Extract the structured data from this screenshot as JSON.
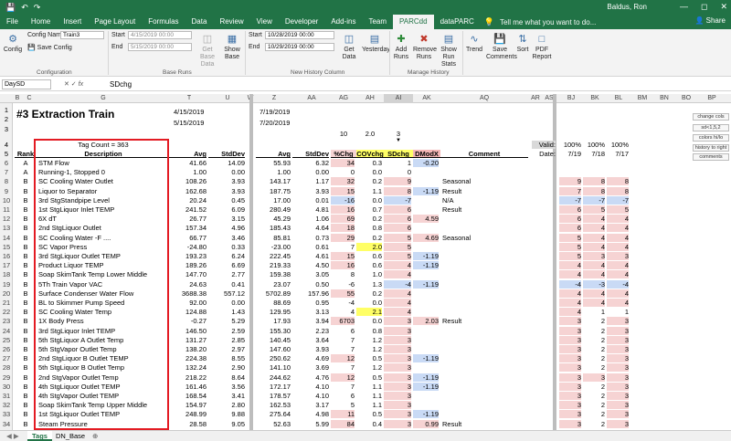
{
  "window": {
    "title": "",
    "user": "Baldus, Ron",
    "share": "Share"
  },
  "tabs": [
    "File",
    "Home",
    "Insert",
    "Page Layout",
    "Formulas",
    "Data",
    "Review",
    "View",
    "Developer",
    "Add-ins",
    "Team",
    "PARCdd",
    "dataPARC"
  ],
  "active_tab": "PARCdd",
  "tell_me": "Tell me what you want to do...",
  "ribbon": {
    "config_label": "Config",
    "config_name_label": "Config Name",
    "config_name_value": "Train3",
    "save_config": "Save Config",
    "start_label": "Start",
    "end_label": "End",
    "base_start": "4/15/2019 00:00",
    "base_end": "5/15/2019 00:00",
    "get_base_data": "Get Base Data",
    "show_base": "Show Base",
    "new_start": "10/28/2019 00:00",
    "new_end": "10/29/2019 00:00",
    "get_data": "Get Data",
    "yesterday": "Yesterday",
    "add_runs": "Add Runs",
    "remove_runs": "Remove Runs",
    "show_run_stats": "Show Run Stats",
    "trend": "Trend",
    "save_comments": "Save Comments",
    "sort": "Sort",
    "pdf_report": "PDF Report",
    "group_configuration": "Configuration",
    "group_base_runs": "Base Runs",
    "group_new_history": "New History Column",
    "group_manage_history": "Manage History"
  },
  "formula_bar": {
    "name_box": "DaySD",
    "formula": "SDchg",
    "fx": "fx"
  },
  "columns": [
    "B",
    "C",
    "G",
    "T",
    "U",
    "W",
    "Z",
    "AA",
    "AG",
    "AH",
    "AI",
    "AK",
    "AQ",
    "AR",
    "AS",
    "BJ",
    "BK",
    "BL",
    "BM",
    "BN",
    "BO",
    "BP"
  ],
  "sheet": {
    "title": "#3 Extraction Train",
    "base_start": "4/15/2019",
    "base_end": "5/15/2019",
    "new_start": "7/19/2019",
    "new_end": "7/20/2019",
    "weights": [
      "10",
      "2.0",
      "3"
    ],
    "tag_count": "Tag Count = 363",
    "valid_label": "Valid:",
    "date_label": "Date:",
    "valid_pcts": [
      "100%",
      "100%",
      "100%"
    ],
    "dates": [
      "7/19",
      "7/18",
      "7/17"
    ],
    "headers": {
      "rank": "Rank",
      "desc": "Description",
      "avg": "Avg",
      "stddev": "StdDev",
      "avg2": "Avg",
      "stddev2": "StdDev",
      "pchg": "%Chg",
      "covchg": "COVchg",
      "sdchg": "SDchg",
      "dmodx": "DModX",
      "comment": "Comment"
    }
  },
  "side_buttons": [
    "change cols",
    "sd<1,5,2",
    "colors hi/lo",
    "history to right",
    "comments"
  ],
  "rows": [
    {
      "n": "6",
      "rank": "A",
      "desc": "STM Flow",
      "avg": "41.66",
      "sd": "14.09",
      "avg2": "55.93",
      "sd2": "6.32",
      "pchg": "34",
      "cov": "0.3",
      "sdc": "1",
      "dmx": "-0.20",
      "cm": "",
      "h": [
        "",
        "",
        ""
      ]
    },
    {
      "n": "7",
      "rank": "A",
      "desc": "Running-1, Stopped 0",
      "avg": "1.00",
      "sd": "0.00",
      "avg2": "1.00",
      "sd2": "0.00",
      "pchg": "0",
      "cov": "0.0",
      "sdc": "0",
      "dmx": "",
      "cm": "",
      "h": [
        "",
        "",
        ""
      ]
    },
    {
      "n": "8",
      "rank": "B",
      "desc": "SC Cooling Water Outlet",
      "avg": "108.26",
      "sd": "3.93",
      "avg2": "143.17",
      "sd2": "1.17",
      "pchg": "32",
      "cov": "0.2",
      "sdc": "9",
      "dmx": "",
      "cm": "Seasonal",
      "h": [
        "9",
        "8",
        "8"
      ]
    },
    {
      "n": "9",
      "rank": "B",
      "desc": "Liquor to Separator",
      "avg": "162.68",
      "sd": "3.93",
      "avg2": "187.75",
      "sd2": "3.93",
      "pchg": "15",
      "cov": "1.1",
      "sdc": "8",
      "dmx": "-1.19",
      "cm": "Result",
      "h": [
        "7",
        "8",
        "8"
      ]
    },
    {
      "n": "10",
      "rank": "B",
      "desc": "3rd StgStandpipe Level",
      "avg": "20.24",
      "sd": "0.45",
      "avg2": "17.00",
      "sd2": "0.01",
      "pchg": "-16",
      "cov": "0.0",
      "sdc": "-7",
      "dmx": "",
      "cm": "N/A",
      "h": [
        "-7",
        "-7",
        "-7"
      ]
    },
    {
      "n": "11",
      "rank": "B",
      "desc": "1st StgLiquor Inlet TEMP",
      "avg": "241.52",
      "sd": "6.09",
      "avg2": "280.49",
      "sd2": "4.81",
      "pchg": "16",
      "cov": "0.7",
      "sdc": "6",
      "dmx": "",
      "cm": "Result",
      "h": [
        "6",
        "5",
        "5"
      ]
    },
    {
      "n": "12",
      "rank": "B",
      "desc": "6X dT",
      "avg": "26.77",
      "sd": "3.15",
      "avg2": "45.29",
      "sd2": "1.06",
      "pchg": "69",
      "cov": "0.2",
      "sdc": "6",
      "dmx": "4.59",
      "cm": "",
      "h": [
        "6",
        "4",
        "4"
      ]
    },
    {
      "n": "13",
      "rank": "B",
      "desc": "2nd StgLiquor Outlet",
      "avg": "157.34",
      "sd": "4.96",
      "avg2": "185.43",
      "sd2": "4.64",
      "pchg": "18",
      "cov": "0.8",
      "sdc": "6",
      "dmx": "",
      "cm": "",
      "h": [
        "6",
        "4",
        "4"
      ]
    },
    {
      "n": "14",
      "rank": "B",
      "desc": "SC Cooling Water -F ....",
      "avg": "66.77",
      "sd": "3.46",
      "avg2": "85.81",
      "sd2": "0.73",
      "pchg": "29",
      "cov": "0.2",
      "sdc": "5",
      "dmx": "4.69",
      "cm": "Seasonal",
      "h": [
        "5",
        "4",
        "4"
      ]
    },
    {
      "n": "15",
      "rank": "B",
      "desc": "SC Vapor Press",
      "avg": "-24.80",
      "sd": "0.33",
      "avg2": "-23.00",
      "sd2": "0.61",
      "pchg": "7",
      "cov": "2.0",
      "sdc": "5",
      "dmx": "",
      "cm": "",
      "h": [
        "5",
        "4",
        "4"
      ]
    },
    {
      "n": "16",
      "rank": "B",
      "desc": "3rd StgLiquor Outlet TEMP",
      "avg": "193.23",
      "sd": "6.24",
      "avg2": "222.45",
      "sd2": "4.61",
      "pchg": "15",
      "cov": "0.6",
      "sdc": "5",
      "dmx": "-1.19",
      "cm": "",
      "h": [
        "5",
        "3",
        "3"
      ]
    },
    {
      "n": "17",
      "rank": "B",
      "desc": "Product Liquor TEMP",
      "avg": "189.26",
      "sd": "6.69",
      "avg2": "219.33",
      "sd2": "4.50",
      "pchg": "16",
      "cov": "0.6",
      "sdc": "4",
      "dmx": "-1.19",
      "cm": "",
      "h": [
        "4",
        "4",
        "4"
      ]
    },
    {
      "n": "18",
      "rank": "B",
      "desc": "Soap SkimTank Temp Lower Middle",
      "avg": "147.70",
      "sd": "2.77",
      "avg2": "159.38",
      "sd2": "3.05",
      "pchg": "8",
      "cov": "1.0",
      "sdc": "4",
      "dmx": "",
      "cm": "",
      "h": [
        "4",
        "4",
        "4"
      ]
    },
    {
      "n": "19",
      "rank": "B",
      "desc": "5Th Train Vapor VAC",
      "avg": "24.63",
      "sd": "0.41",
      "avg2": "23.07",
      "sd2": "0.50",
      "pchg": "-6",
      "cov": "1.3",
      "sdc": "-4",
      "dmx": "-1.19",
      "cm": "",
      "h": [
        "-4",
        "-3",
        "-4"
      ]
    },
    {
      "n": "20",
      "rank": "B",
      "desc": "Surface Condenser Water Flow",
      "avg": "3688.38",
      "sd": "557.12",
      "avg2": "5702.89",
      "sd2": "157.96",
      "pchg": "55",
      "cov": "0.2",
      "sdc": "4",
      "dmx": "",
      "cm": "",
      "h": [
        "4",
        "4",
        "4"
      ]
    },
    {
      "n": "21",
      "rank": "B",
      "desc": "BL to Skimmer Pump Speed",
      "avg": "92.00",
      "sd": "0.00",
      "avg2": "88.69",
      "sd2": "0.95",
      "pchg": "-4",
      "cov": "0.0",
      "sdc": "4",
      "dmx": "",
      "cm": "",
      "h": [
        "4",
        "4",
        "4"
      ]
    },
    {
      "n": "22",
      "rank": "B",
      "desc": "SC Cooling Water Temp",
      "avg": "124.88",
      "sd": "1.43",
      "avg2": "129.95",
      "sd2": "3.13",
      "pchg": "4",
      "cov": "2.1",
      "sdc": "4",
      "dmx": "",
      "cm": "",
      "h": [
        "4",
        "1",
        "1"
      ]
    },
    {
      "n": "23",
      "rank": "B",
      "desc": "1X Body Press",
      "avg": "-0.27",
      "sd": "5.29",
      "avg2": "17.93",
      "sd2": "3.94",
      "pchg": "6703",
      "cov": "0.0",
      "sdc": "3",
      "dmx": "2.03",
      "cm": "Result",
      "h": [
        "3",
        "2",
        "3"
      ]
    },
    {
      "n": "24",
      "rank": "B",
      "desc": "3rd StgLiquor Inlet TEMP",
      "avg": "146.50",
      "sd": "2.59",
      "avg2": "155.30",
      "sd2": "2.23",
      "pchg": "6",
      "cov": "0.8",
      "sdc": "3",
      "dmx": "",
      "cm": "",
      "h": [
        "3",
        "2",
        "3"
      ]
    },
    {
      "n": "25",
      "rank": "B",
      "desc": "5th StgLiquor A Outlet Temp",
      "avg": "131.27",
      "sd": "2.85",
      "avg2": "140.45",
      "sd2": "3.64",
      "pchg": "7",
      "cov": "1.2",
      "sdc": "3",
      "dmx": "",
      "cm": "",
      "h": [
        "3",
        "2",
        "3"
      ]
    },
    {
      "n": "26",
      "rank": "B",
      "desc": "5th StgVapor Outlet Temp",
      "avg": "138.20",
      "sd": "2.97",
      "avg2": "147.60",
      "sd2": "3.93",
      "pchg": "7",
      "cov": "1.2",
      "sdc": "3",
      "dmx": "",
      "cm": "",
      "h": [
        "3",
        "2",
        "3"
      ]
    },
    {
      "n": "27",
      "rank": "B",
      "desc": "2nd StgLiquor B Outlet TEMP",
      "avg": "224.38",
      "sd": "8.55",
      "avg2": "250.62",
      "sd2": "4.69",
      "pchg": "12",
      "cov": "0.5",
      "sdc": "3",
      "dmx": "-1.19",
      "cm": "",
      "h": [
        "3",
        "2",
        "3"
      ]
    },
    {
      "n": "28",
      "rank": "B",
      "desc": "5th StgLiquor B Outlet Temp",
      "avg": "132.24",
      "sd": "2.90",
      "avg2": "141.10",
      "sd2": "3.69",
      "pchg": "7",
      "cov": "1.2",
      "sdc": "3",
      "dmx": "",
      "cm": "",
      "h": [
        "3",
        "2",
        "3"
      ]
    },
    {
      "n": "29",
      "rank": "B",
      "desc": "2nd StgVapor Outlet Temp",
      "avg": "218.22",
      "sd": "8.64",
      "avg2": "244.62",
      "sd2": "4.76",
      "pchg": "12",
      "cov": "0.5",
      "sdc": "3",
      "dmx": "-1.19",
      "cm": "",
      "h": [
        "3",
        "3",
        "3"
      ]
    },
    {
      "n": "30",
      "rank": "B",
      "desc": "4th StgLiquor Outlet TEMP",
      "avg": "161.46",
      "sd": "3.56",
      "avg2": "172.17",
      "sd2": "4.10",
      "pchg": "7",
      "cov": "1.1",
      "sdc": "3",
      "dmx": "-1.19",
      "cm": "",
      "h": [
        "3",
        "2",
        "3"
      ]
    },
    {
      "n": "31",
      "rank": "B",
      "desc": "4th StgVapor Outlet TEMP",
      "avg": "168.54",
      "sd": "3.41",
      "avg2": "178.57",
      "sd2": "4.10",
      "pchg": "6",
      "cov": "1.1",
      "sdc": "3",
      "dmx": "",
      "cm": "",
      "h": [
        "3",
        "2",
        "3"
      ]
    },
    {
      "n": "32",
      "rank": "B",
      "desc": "Soap SkimTank Temp Upper Middle",
      "avg": "154.97",
      "sd": "2.80",
      "avg2": "162.53",
      "sd2": "3.17",
      "pchg": "5",
      "cov": "1.1",
      "sdc": "3",
      "dmx": "",
      "cm": "",
      "h": [
        "3",
        "2",
        "3"
      ]
    },
    {
      "n": "33",
      "rank": "B",
      "desc": "1st StgLiquor Outlet TEMP",
      "avg": "248.99",
      "sd": "9.88",
      "avg2": "275.64",
      "sd2": "4.98",
      "pchg": "11",
      "cov": "0.5",
      "sdc": "3",
      "dmx": "-1.19",
      "cm": "",
      "h": [
        "3",
        "2",
        "3"
      ]
    },
    {
      "n": "34",
      "rank": "B",
      "desc": "Steam Pressure",
      "avg": "28.58",
      "sd": "9.05",
      "avg2": "52.63",
      "sd2": "5.99",
      "pchg": "84",
      "cov": "0.4",
      "sdc": "3",
      "dmx": "0.99",
      "cm": "Result",
      "h": [
        "3",
        "2",
        "3"
      ]
    }
  ],
  "sheet_tabs": [
    "Tags",
    "DN_Base"
  ],
  "colors": {
    "excel_green": "#217346",
    "pink": "#f6d3d3",
    "blue": "#c9daf5",
    "yellow": "#ffff66",
    "redbox": "#e31b23"
  }
}
